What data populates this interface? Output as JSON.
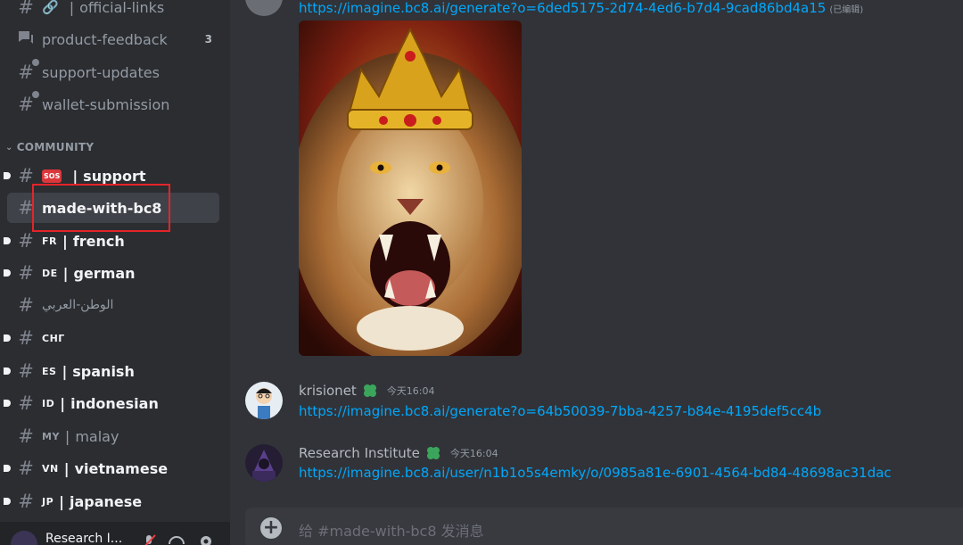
{
  "sidebar": {
    "top_channels": [
      {
        "name": "official-links",
        "icon": "link-icon",
        "prefix": "|"
      },
      {
        "name": "product-feedback",
        "icon": "forum-icon",
        "count": "3"
      },
      {
        "name": "support-updates",
        "icon": "hash-icon"
      },
      {
        "name": "wallet-submission",
        "icon": "hash-icon"
      }
    ],
    "category": "COMMUNITY",
    "community_channels": [
      {
        "flag": "SOS",
        "name": "support"
      },
      {
        "name": "made-with-bc8"
      },
      {
        "flag": "FR",
        "name": "french"
      },
      {
        "flag": "DE",
        "name": "german"
      },
      {
        "name": "الوطن-العربي"
      },
      {
        "flag": "CHГ",
        "name": ""
      },
      {
        "flag": "ES",
        "name": "spanish"
      },
      {
        "flag": "ID",
        "name": "indonesian"
      },
      {
        "flag": "MY",
        "name": "malay"
      },
      {
        "flag": "VN",
        "name": "vietnamese"
      },
      {
        "flag": "JP",
        "name": "japanese"
      }
    ],
    "user": {
      "name": "Research I..."
    }
  },
  "messages": [
    {
      "link": "https://imagine.bc8.ai/generate?o=6ded5175-2d74-4ed6-b7d4-9cad86bd4a15",
      "edited": "(已编辑)"
    },
    {
      "author": "krisionet",
      "time": "今天16:04",
      "link": "https://imagine.bc8.ai/generate?o=64b50039-7bba-4257-b84e-4195def5cc4b"
    },
    {
      "author": "Research Institute",
      "time": "今天16:04",
      "link": "https://imagine.bc8.ai/user/n1b1o5s4emky/o/0985a81e-6901-4564-bd84-48698ac31dac"
    }
  ],
  "composer": {
    "placeholder": "给 #made-with-bc8 发消息"
  },
  "colors": {
    "link": "#00a8fc",
    "highlight": "#e5242a",
    "badge": "#3ba55c"
  }
}
